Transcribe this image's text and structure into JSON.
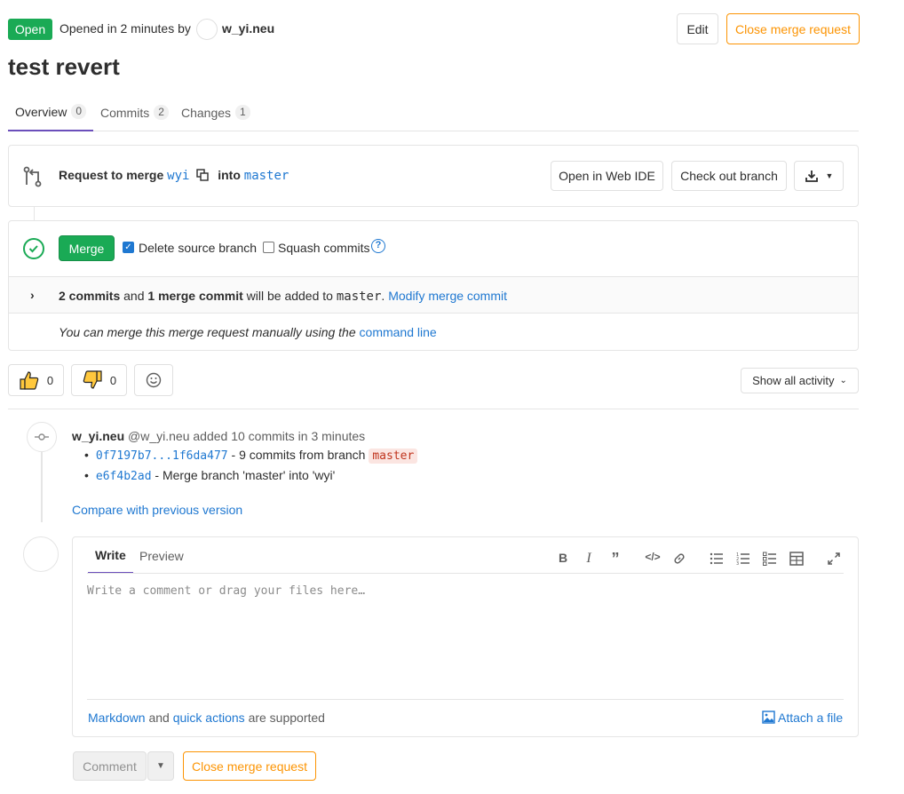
{
  "header": {
    "status": "Open",
    "opened_text": "Opened in 2 minutes by",
    "author": "w_yi.neu",
    "edit_label": "Edit",
    "close_label": "Close merge request",
    "title": "test revert"
  },
  "tabs": [
    {
      "label": "Overview",
      "count": "0"
    },
    {
      "label": "Commits",
      "count": "2"
    },
    {
      "label": "Changes",
      "count": "1"
    }
  ],
  "branch": {
    "request_label": "Request to merge",
    "source": "wyi",
    "into_label": "into",
    "target": "master",
    "web_ide_label": "Open in Web IDE",
    "checkout_label": "Check out branch"
  },
  "merge": {
    "merge_label": "Merge",
    "delete_branch_label": "Delete source branch",
    "delete_branch_checked": true,
    "squash_label": "Squash commits",
    "squash_checked": false,
    "commits_count": "2 commits",
    "and_text": "and",
    "merge_commit_count": "1 merge commit",
    "added_text": "will be added to",
    "target": "master",
    "period": ".",
    "modify_label": "Modify merge commit",
    "manual_text": "You can merge this merge request manually using the",
    "command_line_label": "command line"
  },
  "awards": {
    "thumbs_up_count": "0",
    "thumbs_down_count": "0",
    "activity_label": "Show all activity"
  },
  "timeline": {
    "author": "w_yi.neu",
    "handle": "@w_yi.neu",
    "action": "added 10 commits in 3 minutes",
    "commit_range": "0f7197b7...1f6da477",
    "commit_range_desc": "- 9 commits from branch",
    "branch_chip": "master",
    "commit_sha": "e6f4b2ad",
    "commit_msg": "- Merge branch 'master' into 'wyi'",
    "compare_label": "Compare with previous version"
  },
  "comment": {
    "write_label": "Write",
    "preview_label": "Preview",
    "placeholder": "Write a comment or drag your files here…",
    "markdown_label": "Markdown",
    "and_text": "and",
    "quick_actions_label": "quick actions",
    "supported_text": "are supported",
    "attach_label": "Attach a file",
    "comment_button": "Comment",
    "close_label": "Close merge request"
  },
  "colors": {
    "green": "#1aaa55",
    "link": "#1f78d1",
    "orange": "#fc9403",
    "tab_active": "#6b4fbb"
  }
}
